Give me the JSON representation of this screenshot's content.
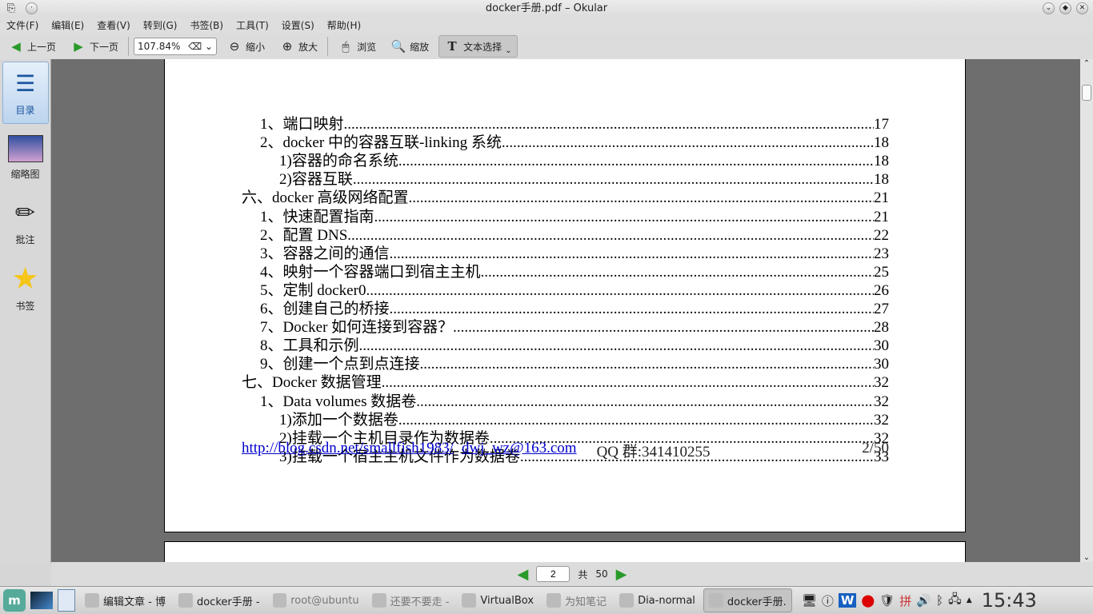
{
  "window": {
    "title": "docker手册.pdf – Okular"
  },
  "menu": [
    "文件(F)",
    "编辑(E)",
    "查看(V)",
    "转到(G)",
    "书签(B)",
    "工具(T)",
    "设置(S)",
    "帮助(H)"
  ],
  "toolbar": {
    "prev": "上一页",
    "next": "下一页",
    "zoom": "107.84%",
    "zoom_out": "缩小",
    "zoom_in": "放大",
    "browse": "浏览",
    "zoom_tool": "缩放",
    "text_select": "文本选择"
  },
  "sidebar": [
    {
      "label": "目录"
    },
    {
      "label": "缩略图"
    },
    {
      "label": "批注"
    },
    {
      "label": "书签"
    }
  ],
  "toc": [
    {
      "level": 1,
      "title": "1、端口映射",
      "page": "17"
    },
    {
      "level": 1,
      "title": "2、docker 中的容器互联-linking 系统",
      "page": "18"
    },
    {
      "level": 2,
      "title": "1)容器的命名系统",
      "page": "18"
    },
    {
      "level": 2,
      "title": "2)容器互联",
      "page": "18"
    },
    {
      "level": 0,
      "title": "六、docker 高级网络配置",
      "page": "21"
    },
    {
      "level": 1,
      "title": "1、快速配置指南",
      "page": "21"
    },
    {
      "level": 1,
      "title": "2、配置 DNS",
      "page": "22"
    },
    {
      "level": 1,
      "title": "3、容器之间的通信",
      "page": "23"
    },
    {
      "level": 1,
      "title": "4、映射一个容器端口到宿主主机",
      "page": "25"
    },
    {
      "level": 1,
      "title": "5、定制 docker0",
      "page": "26"
    },
    {
      "level": 1,
      "title": "6、创建自己的桥接",
      "page": "27"
    },
    {
      "level": 1,
      "title": "7、Docker 如何连接到容器？",
      "page": "28"
    },
    {
      "level": 1,
      "title": "8、工具和示例",
      "page": "30"
    },
    {
      "level": 1,
      "title": "9、创建一个点到点连接",
      "page": "30"
    },
    {
      "level": 0,
      "title": "七、Docker 数据管理",
      "page": "32"
    },
    {
      "level": 1,
      "title": "1、Data volumes 数据卷",
      "page": "32"
    },
    {
      "level": 2,
      "title": "1)添加一个数据卷",
      "page": "32"
    },
    {
      "level": 2,
      "title": "2)挂载一个主机目录作为数据卷",
      "page": "32"
    },
    {
      "level": 2,
      "title": "3)挂载一个宿主主机文件作为数据卷",
      "page": "33"
    }
  ],
  "footer": {
    "link1": "http://blog.csdn.net/smallfish1983/",
    "link2": "dwj_wz@163.com",
    "qq": "QQ 群:341410255",
    "page": "2/50"
  },
  "pagenav": {
    "current": "2",
    "of": "共",
    "total": "50"
  },
  "taskbar": [
    {
      "label": "编辑文章 - 博",
      "dim": false
    },
    {
      "label": "docker手册 -",
      "dim": false
    },
    {
      "label": "root@ubuntu",
      "dim": true
    },
    {
      "label": "还要不要走 -",
      "dim": true
    },
    {
      "label": "VirtualBox",
      "dim": false
    },
    {
      "label": "为知笔记",
      "dim": true
    },
    {
      "label": "Dia-normal",
      "dim": false
    },
    {
      "label": "docker手册.",
      "dim": false,
      "active": true
    }
  ],
  "clock": "15:43"
}
